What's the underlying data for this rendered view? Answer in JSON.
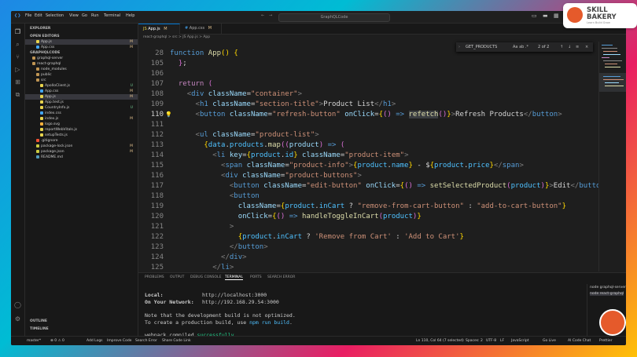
{
  "titlebar": {
    "menu": [
      "File",
      "Edit",
      "Selection",
      "View",
      "Go",
      "Run",
      "Terminal",
      "Help"
    ],
    "search": "GraphQLCode"
  },
  "sidebar": {
    "title": "EXPLORER",
    "open_editors": "OPEN EDITORS",
    "open_files": [
      {
        "name": "App.js",
        "path": "react-graphql/src",
        "mod": "M"
      },
      {
        "name": "App.css",
        "path": "react-graphql/src",
        "mod": "M"
      }
    ],
    "project": "GRAPHQLCODE",
    "tree": [
      {
        "name": "graphql-server",
        "indent": 1,
        "mod": ""
      },
      {
        "name": "react-graphql",
        "indent": 1,
        "mod": ""
      },
      {
        "name": "node_modules",
        "indent": 2,
        "mod": ""
      },
      {
        "name": "public",
        "indent": 2,
        "mod": ""
      },
      {
        "name": "src",
        "indent": 2,
        "mod": ""
      },
      {
        "name": "ApolloClient.js",
        "indent": 3,
        "mod": "U"
      },
      {
        "name": "App.css",
        "indent": 3,
        "mod": "M"
      },
      {
        "name": "App.js",
        "indent": 3,
        "mod": "M"
      },
      {
        "name": "App.test.js",
        "indent": 3,
        "mod": ""
      },
      {
        "name": "CountryInfo.js",
        "indent": 3,
        "mod": "U"
      },
      {
        "name": "index.css",
        "indent": 3,
        "mod": ""
      },
      {
        "name": "index.js",
        "indent": 3,
        "mod": "M"
      },
      {
        "name": "logo.svg",
        "indent": 3,
        "mod": ""
      },
      {
        "name": "reportWebVitals.js",
        "indent": 3,
        "mod": ""
      },
      {
        "name": "setupTests.js",
        "indent": 3,
        "mod": ""
      },
      {
        "name": ".gitignore",
        "indent": 2,
        "mod": ""
      },
      {
        "name": "package-lock.json",
        "indent": 2,
        "mod": "M"
      },
      {
        "name": "package.json",
        "indent": 2,
        "mod": "M"
      },
      {
        "name": "README.md",
        "indent": 2,
        "mod": ""
      }
    ],
    "outline": "OUTLINE",
    "timeline": "TIMELINE"
  },
  "tabs": [
    {
      "label": "App.js",
      "mod": "M"
    },
    {
      "label": "App.css",
      "mod": "M"
    }
  ],
  "breadcrumb": "react-graphql > src > JS App.js > App",
  "find": {
    "query": "GET_PRODUCTS",
    "options": "Aa ab .*",
    "count": "2 of 2"
  },
  "editor": {
    "current_line": 110,
    "lines": [
      {
        "n": 28,
        "html": "<span class=\"k\">function</span> <span class=\"f\">App</span><span class=\"b\">()</span> <span class=\"b\">{</span>"
      },
      {
        "n": 105,
        "html": "  <span class=\"p\">}</span>;"
      },
      {
        "n": 106,
        "html": ""
      },
      {
        "n": 107,
        "html": "  <span class=\"kc\">return</span> <span class=\"p\">(</span>"
      },
      {
        "n": 108,
        "html": "    <span class=\"tg\">&lt;</span><span class=\"k\">div</span> <span class=\"a\">className</span>=<span class=\"s\">\"container\"</span><span class=\"tg\">&gt;</span>"
      },
      {
        "n": 109,
        "html": "      <span class=\"tg\">&lt;</span><span class=\"k\">h1</span> <span class=\"a\">className</span>=<span class=\"s\">\"section-title\"</span><span class=\"tg\">&gt;</span>Product List<span class=\"tg\">&lt;/</span><span class=\"k\">h1</span><span class=\"tg\">&gt;</span>"
      },
      {
        "n": 110,
        "html": "      <span class=\"tg\">&lt;</span><span class=\"k\">button</span> <span class=\"a\">className</span>=<span class=\"s\">\"refresh-button\"</span> <span class=\"a\">onClick</span>=<span class=\"b\">{</span><span class=\"p\">()</span> <span class=\"k\">=&gt;</span> <span class=\"f hl\">refetch</span><span class=\"p\">()</span><span class=\"b\">}</span><span class=\"tg\">&gt;</span>Refresh Products<span class=\"tg\">&lt;/</span><span class=\"k\">button</span><span class=\"tg\">&gt;</span>"
      },
      {
        "n": 111,
        "html": ""
      },
      {
        "n": 112,
        "html": "      <span class=\"tg\">&lt;</span><span class=\"k\">ul</span> <span class=\"a\">className</span>=<span class=\"s\">\"product-list\"</span><span class=\"tg\">&gt;</span>"
      },
      {
        "n": 113,
        "html": "        <span class=\"b\">{</span><span class=\"v\">data</span>.<span class=\"v\">products</span>.<span class=\"f\">map</span><span class=\"p\">((</span><span class=\"a\">product</span><span class=\"p\">)</span> <span class=\"k\">=&gt;</span> <span class=\"p\">(</span>"
      },
      {
        "n": 114,
        "html": "          <span class=\"tg\">&lt;</span><span class=\"k\">li</span> <span class=\"a\">key</span>=<span class=\"b\">{</span><span class=\"v\">product</span>.<span class=\"v\">id</span><span class=\"b\">}</span> <span class=\"a\">className</span>=<span class=\"s\">\"product-item\"</span><span class=\"tg\">&gt;</span>"
      },
      {
        "n": 115,
        "html": "            <span class=\"tg\">&lt;</span><span class=\"k\">span</span> <span class=\"a\">className</span>=<span class=\"s\">\"product-info\"</span><span class=\"tg\">&gt;</span><span class=\"b\">{</span><span class=\"v\">product</span>.<span class=\"v\">name</span><span class=\"b\">}</span> - $<span class=\"b\">{</span><span class=\"v\">product</span>.<span class=\"v\">price</span><span class=\"b\">}</span><span class=\"tg\">&lt;/</span><span class=\"k\">span</span><span class=\"tg\">&gt;</span>"
      },
      {
        "n": 116,
        "html": "            <span class=\"tg\">&lt;</span><span class=\"k\">div</span> <span class=\"a\">className</span>=<span class=\"s\">\"product-buttons\"</span><span class=\"tg\">&gt;</span>"
      },
      {
        "n": 117,
        "html": "              <span class=\"tg\">&lt;</span><span class=\"k\">button</span> <span class=\"a\">className</span>=<span class=\"s\">\"edit-button\"</span> <span class=\"a\">onClick</span>=<span class=\"b\">{</span><span class=\"p\">()</span> <span class=\"k\">=&gt;</span> <span class=\"f\">setSelectedProduct</span><span class=\"p\">(</span><span class=\"v\">product</span><span class=\"p\">)</span><span class=\"b\">}</span><span class=\"tg\">&gt;</span>Edit<span class=\"tg\">&lt;/</span><span class=\"k\">butto</span>"
      },
      {
        "n": 118,
        "html": "              <span class=\"tg\">&lt;</span><span class=\"k\">button</span>"
      },
      {
        "n": 119,
        "html": "                <span class=\"a\">className</span>=<span class=\"b\">{</span><span class=\"v\">product</span>.<span class=\"v\">inCart</span> ? <span class=\"s\">\"remove-from-cart-button\"</span> : <span class=\"s\">\"add-to-cart-button\"</span><span class=\"b\">}</span>"
      },
      {
        "n": 120,
        "html": "                <span class=\"a\">onClick</span>=<span class=\"b\">{</span><span class=\"p\">()</span> <span class=\"k\">=&gt;</span> <span class=\"f\">handleToggleInCart</span><span class=\"p\">(</span><span class=\"v\">product</span><span class=\"p\">)</span><span class=\"b\">}</span>"
      },
      {
        "n": 121,
        "html": "              <span class=\"tg\">&gt;</span>"
      },
      {
        "n": 122,
        "html": "                <span class=\"b\">{</span><span class=\"v\">product</span>.<span class=\"v\">inCart</span> ? <span class=\"s\">'Remove from Cart'</span> : <span class=\"s\">'Add to Cart'</span><span class=\"b\">}</span>"
      },
      {
        "n": 123,
        "html": "              <span class=\"tg\">&lt;/</span><span class=\"k\">button</span><span class=\"tg\">&gt;</span>"
      },
      {
        "n": 124,
        "html": "            <span class=\"tg\">&lt;/</span><span class=\"k\">div</span><span class=\"tg\">&gt;</span>"
      },
      {
        "n": 125,
        "html": "          <span class=\"tg\">&lt;/</span><span class=\"k\">li</span><span class=\"tg\">&gt;</span>"
      }
    ]
  },
  "panel": {
    "tabs": [
      "PROBLEMS",
      "OUTPUT",
      "DEBUG CONSOLE",
      "TERMINAL",
      "PORTS",
      "SEARCH ERROR"
    ],
    "active_tab": "TERMINAL",
    "terminal": {
      "local_label": "Local:",
      "local_url": "http://localhost:3000",
      "network_label": "On Your Network:",
      "network_url": "http://192.168.29.54:3000",
      "note1": "Note that the development build is not optimized.",
      "note2_a": "To create a production build, use ",
      "note2_cmd": "npm run build",
      "note2_b": ".",
      "compiled_a": "webpack compiled ",
      "compiled_b": "successfully"
    },
    "terminals": [
      "node graphql-server",
      "node react-graphql"
    ]
  },
  "status": {
    "branch": "master*",
    "sync": "⊗ 0 ⚠ 0",
    "items_left": [
      "Add Logs",
      "Improve Code",
      "Search Error",
      "Share Code Link"
    ],
    "position": "Ln 110, Col 64 (7 selected)",
    "spaces": "Spaces: 2",
    "encoding": "UTF-8",
    "eol": "LF",
    "language": "JavaScript",
    "golive": "Go Live",
    "chat": "AI Code Chat",
    "prettier": "Prettier"
  },
  "brand": {
    "line1": "SKILL",
    "line2": "BAKERY",
    "tagline": "Learn Build Grow"
  },
  "colors": {
    "accent": "#0078d4",
    "editor_bg": "#1e1e1e",
    "sidebar_bg": "#181818",
    "brand_orange": "#e55a2b"
  }
}
